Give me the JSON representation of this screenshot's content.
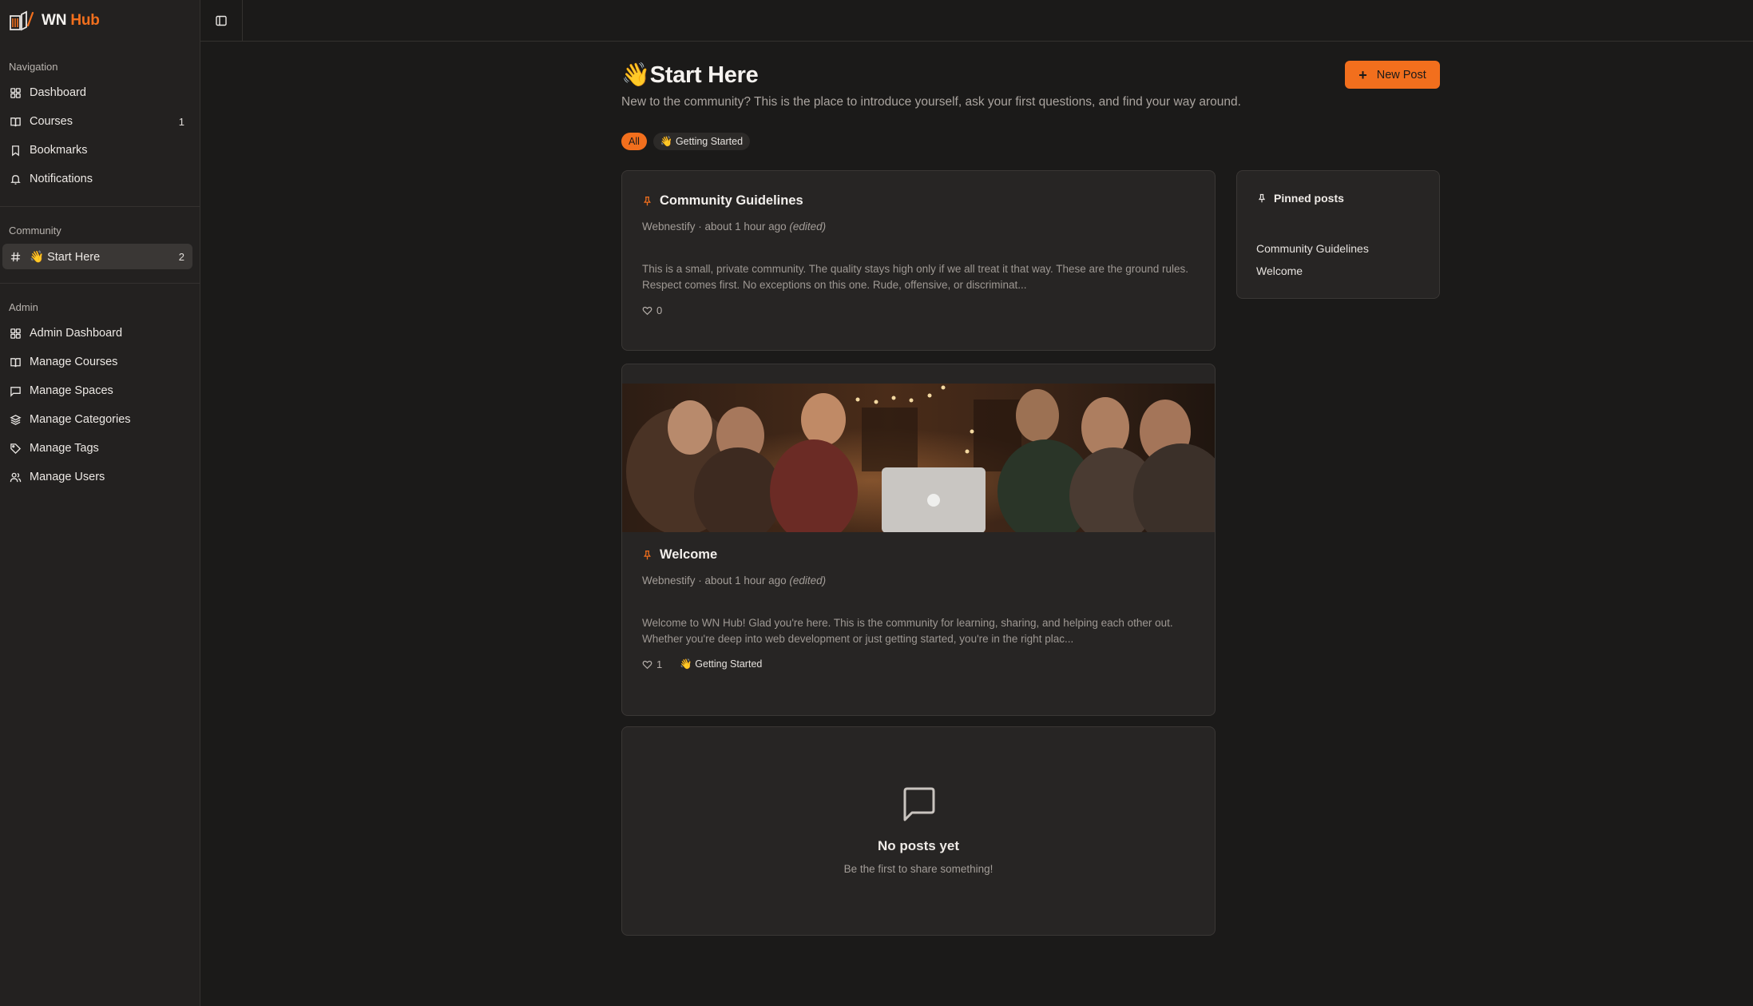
{
  "brand": {
    "name_part1": "WN",
    "name_part2": "Hub"
  },
  "sidebar": {
    "navigation_label": "Navigation",
    "navigation_items": [
      {
        "label": "Dashboard",
        "icon": "grid-icon"
      },
      {
        "label": "Courses",
        "icon": "book-icon",
        "count": "1"
      },
      {
        "label": "Bookmarks",
        "icon": "bookmark-icon"
      },
      {
        "label": "Notifications",
        "icon": "bell-icon"
      }
    ],
    "community_label": "Community",
    "community_items": [
      {
        "label": "👋 Start Here",
        "icon": "hash-icon",
        "count": "2",
        "active": true
      }
    ],
    "admin_label": "Admin",
    "admin_items": [
      {
        "label": "Admin Dashboard",
        "icon": "grid-icon"
      },
      {
        "label": "Manage Courses",
        "icon": "book-icon"
      },
      {
        "label": "Manage Spaces",
        "icon": "message-square-icon"
      },
      {
        "label": "Manage Categories",
        "icon": "layers-icon"
      },
      {
        "label": "Manage Tags",
        "icon": "tag-icon"
      },
      {
        "label": "Manage Users",
        "icon": "users-icon"
      }
    ]
  },
  "page": {
    "title": "👋Start Here",
    "description": "New to the community? This is the place to introduce yourself, ask your first questions, and find your way around.",
    "new_post_label": "New Post"
  },
  "filters": [
    {
      "label": "All",
      "active": true
    },
    {
      "label": "👋 Getting Started",
      "active": false
    }
  ],
  "posts": [
    {
      "title": "Community Guidelines",
      "author": "Webnestify",
      "time": "about 1 hour ago",
      "edited": "(edited)",
      "excerpt": "This is a small, private community. The quality stays high only if we all treat it that way. These are the ground rules. Respect comes first. No exceptions on this one. Rude, offensive, or discriminat...",
      "likes": "0",
      "tag": ""
    },
    {
      "title": "Welcome",
      "author": "Webnestify",
      "time": "about 1 hour ago",
      "edited": "(edited)",
      "excerpt": "Welcome to WN Hub! Glad you're here. This is the community for learning, sharing, and helping each other out. Whether you're deep into web development or just getting started, you're in the right plac...",
      "likes": "1",
      "tag": "👋 Getting Started"
    }
  ],
  "empty_state": {
    "title": "No posts yet",
    "subtitle": "Be the first to share something!"
  },
  "pinned": {
    "heading": "Pinned posts",
    "items": [
      "Community Guidelines",
      "Welcome"
    ]
  },
  "colors": {
    "accent": "#f26f1d",
    "background": "#1b1a19",
    "sidebar": "#232120",
    "card": "#272524"
  }
}
